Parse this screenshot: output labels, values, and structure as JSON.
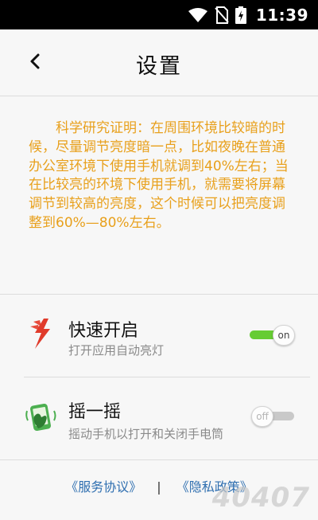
{
  "status_bar": {
    "time": "11:39"
  },
  "header": {
    "title": "设置"
  },
  "notice": "科学研究证明：在周围环境比较暗的时候，尽量调节亮度暗一点，比如夜晚在普通办公室环境下使用手机就调到40%左右；当在比较亮的环境下使用手机，就需要将屏幕调节到较高的亮度，这个时候可以把亮度调整到60%—80%左右。",
  "settings": [
    {
      "title": "快速开启",
      "subtitle": "打开应用自动亮灯",
      "state": "on",
      "toggle_label": "on",
      "icon": "lightning-icon"
    },
    {
      "title": "摇一摇",
      "subtitle": "摇动手机以打开和关闭手电筒",
      "state": "off",
      "toggle_label": "off",
      "icon": "shake-phone-icon"
    }
  ],
  "footer": {
    "terms": "《服务协议》",
    "separator": "|",
    "privacy": "《隐私政策》"
  },
  "watermark": "40407",
  "colors": {
    "notice": "#e8a01c",
    "link": "#2f6fb0",
    "toggle_on": "#66cc33"
  }
}
